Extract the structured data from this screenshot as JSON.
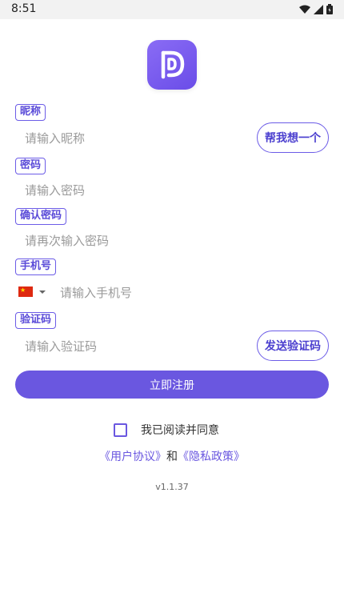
{
  "status_bar": {
    "time": "8:51",
    "icons": [
      "wifi-icon",
      "signal-icon",
      "battery-icon"
    ]
  },
  "form": {
    "nickname": {
      "label": "昵称",
      "placeholder": "请输入昵称",
      "button": "帮我想一个"
    },
    "password": {
      "label": "密码",
      "placeholder": "请输入密码"
    },
    "confirm_password": {
      "label": "确认密码",
      "placeholder": "请再次输入密码"
    },
    "phone": {
      "label": "手机号",
      "placeholder": "请输入手机号",
      "country_flag": "china-flag-icon"
    },
    "verification": {
      "label": "验证码",
      "placeholder": "请输入验证码",
      "button": "发送验证码"
    },
    "submit_label": "立即注册"
  },
  "agreement": {
    "checkbox_label": "我已阅读并同意",
    "checked": false,
    "user_agreement": "《用户协议》",
    "conjunction": "和",
    "privacy_policy": "《隐私政策》"
  },
  "version": "v1.1.37",
  "colors": {
    "accent": "#6a57e0",
    "label_border": "#6c5ce7",
    "placeholder": "#9a9a9a"
  }
}
